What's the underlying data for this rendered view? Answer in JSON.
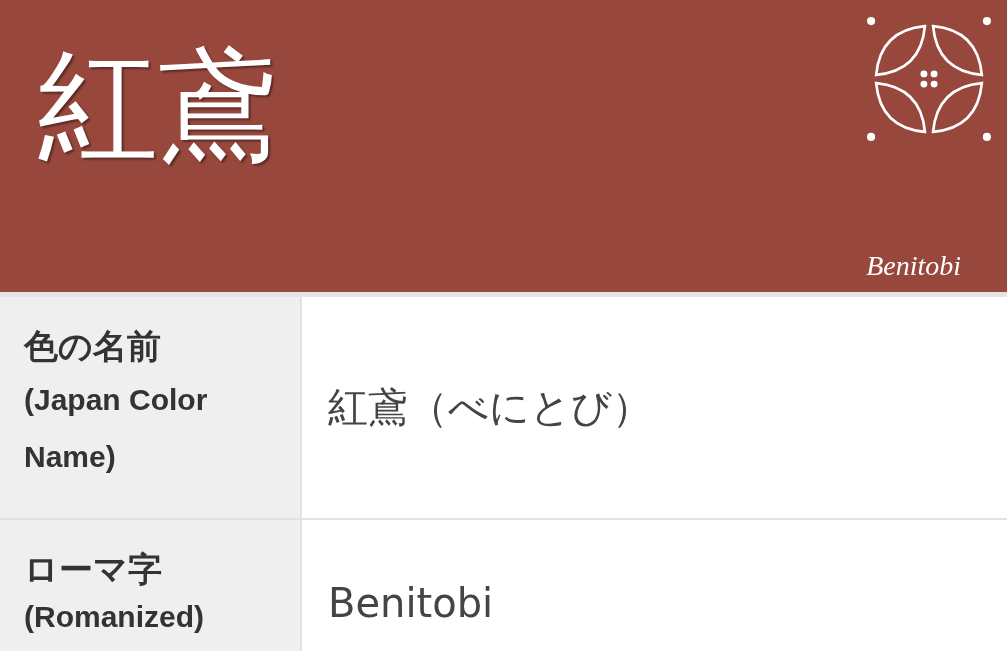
{
  "header": {
    "title": "紅鳶",
    "subtitle": "Benitobi"
  },
  "table": {
    "rows": [
      {
        "label": "色の名前",
        "label_note": "(Japan Color Name)",
        "value": "紅鳶（べにとび）"
      },
      {
        "label": "ローマ字",
        "label_note": "(Romanized)",
        "value": "Benitobi"
      }
    ]
  }
}
